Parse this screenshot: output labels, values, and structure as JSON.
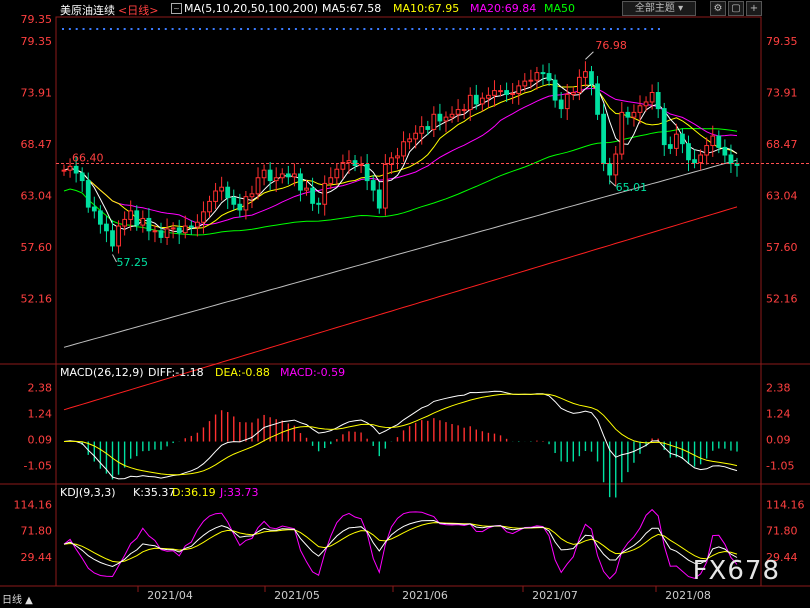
{
  "header": {
    "instrument": "美原油连续",
    "period": "<日线>",
    "ma_label": "MA(5,10,20,50,100,200)",
    "ma_values": [
      {
        "text": "MA5:67.58",
        "color": "#ffffff"
      },
      {
        "text": "MA10:67.95",
        "color": "#ffff00"
      },
      {
        "text": "MA20:69.84",
        "color": "#ff00ff"
      },
      {
        "text": "MA50",
        "color": "#00ff00"
      }
    ],
    "theme_button": "全部主题",
    "colors": {
      "instrument": "#ffffff",
      "period": "#ff4040",
      "ma_label": "#ffffff"
    }
  },
  "price_axis": {
    "ticks": [
      "79.35",
      "73.91",
      "68.47",
      "63.04",
      "57.60",
      "52.16"
    ],
    "tick_values": [
      79.35,
      73.91,
      68.47,
      63.04,
      57.6,
      52.16
    ],
    "range": [
      46.5,
      80.5
    ],
    "label_color": "#ff4040"
  },
  "annotations": {
    "high": "76.98",
    "low_left": "57.25",
    "low_right": "65.01",
    "ref_line": "66.40"
  },
  "macd": {
    "label": "MACD(26,12,9)",
    "diff": "DIFF:-1.18",
    "dea": "DEA:-0.88",
    "macd": "MACD:-0.59",
    "ticks": [
      "2.38",
      "1.24",
      "0.09",
      "-1.05"
    ],
    "tick_values": [
      2.38,
      1.24,
      0.09,
      -1.05
    ],
    "range": [
      -1.6,
      2.7
    ],
    "colors": {
      "diff": "#ffffff",
      "dea": "#ffff00",
      "macd": "#ff00ff"
    }
  },
  "kdj": {
    "label": "KDJ(9,3,3)",
    "k": "K:35.37",
    "d": "D:36.19",
    "j": "J:33.73",
    "ticks": [
      "114.16",
      "71.80",
      "29.44"
    ],
    "tick_values": [
      114.16,
      71.8,
      29.44
    ],
    "range": [
      -5,
      125
    ],
    "colors": {
      "k": "#ffffff",
      "d": "#ffff00",
      "j": "#ff00ff"
    }
  },
  "date_axis": [
    "2021/04",
    "2021/05",
    "2021/06",
    "2021/07",
    "2021/08"
  ],
  "footer": {
    "period_label": "日线 ▲"
  },
  "watermark": "FX678",
  "chart_data": {
    "type": "candlestick",
    "close": [
      65.7,
      66.1,
      65.4,
      64.6,
      61.8,
      61.4,
      60.0,
      59.3,
      57.7,
      59.8,
      60.5,
      61.4,
      59.9,
      60.6,
      59.3,
      59.3,
      58.6,
      59.5,
      59.6,
      59.1,
      59.8,
      59.7,
      60.2,
      61.3,
      62.4,
      63.5,
      63.9,
      62.8,
      62.1,
      61.5,
      62.9,
      63.2,
      64.9,
      65.7,
      64.6,
      64.9,
      65.3,
      65.0,
      65.3,
      63.6,
      63.8,
      62.2,
      62.1,
      64.3,
      64.9,
      65.8,
      66.5,
      66.7,
      66.2,
      66.3,
      64.6,
      63.6,
      61.7,
      66.3,
      67.0,
      67.2,
      68.7,
      69.0,
      69.6,
      70.3,
      70.0,
      71.6,
      70.9,
      71.3,
      71.6,
      72.1,
      72.1,
      73.6,
      72.7,
      73.3,
      73.6,
      74.1,
      74.1,
      73.7,
      73.8,
      74.6,
      75.1,
      75.2,
      76.0,
      75.9,
      75.2,
      73.1,
      72.2,
      73.7,
      73.9,
      75.5,
      76.1,
      74.8,
      71.6,
      66.4,
      65.2,
      67.4,
      71.8,
      71.3,
      71.8,
      72.5,
      72.9,
      73.9,
      72.2,
      68.4,
      68.0,
      69.5,
      68.5,
      66.8,
      66.5,
      67.3,
      68.3,
      69.3,
      68.1,
      67.3,
      66.4,
      66.2
    ],
    "ma_series": [
      "MA5",
      "MA10",
      "MA20",
      "MA50",
      "MA100",
      "MA200"
    ],
    "diff": "-1.18",
    "dea": "-0.88",
    "macd": "-0.59",
    "k": "35.37",
    "d": "36.19",
    "j": "33.73",
    "up_color": "#ff3030",
    "down_color": "#00e0a0"
  }
}
